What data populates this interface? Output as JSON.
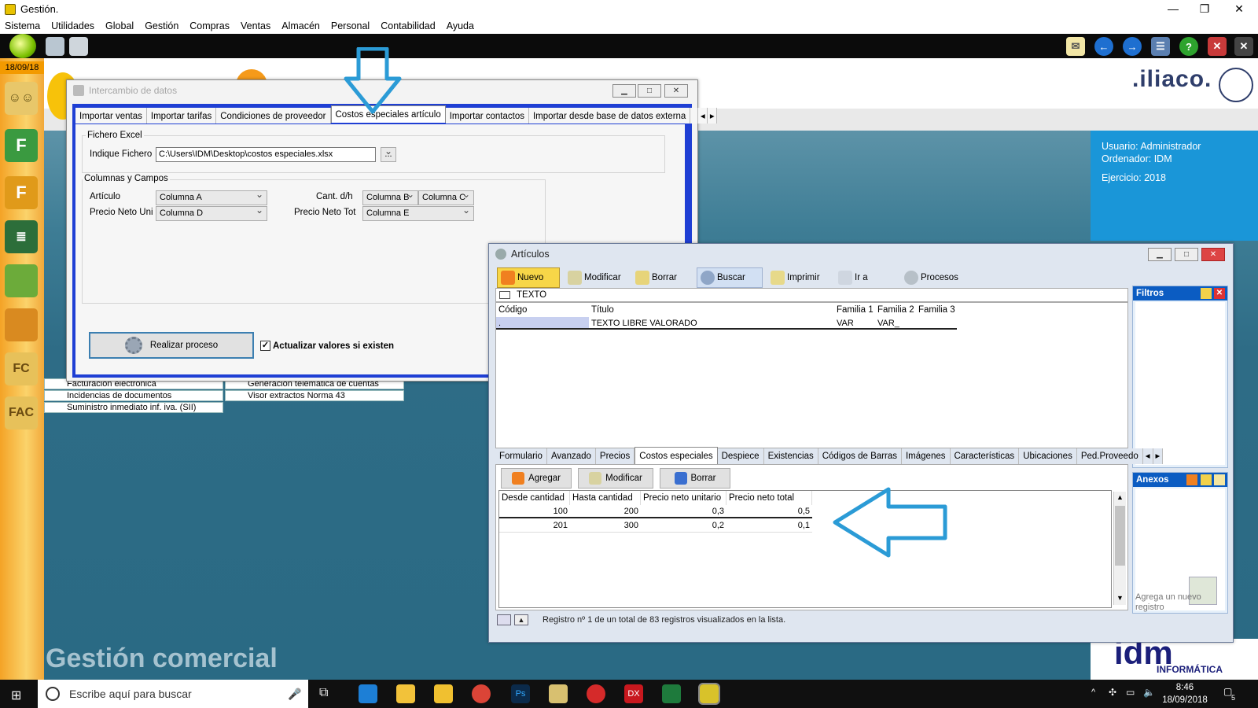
{
  "app": {
    "title": "Gestión.",
    "date_badge": "18/09/18"
  },
  "menu": [
    "Sistema",
    "Utilidades",
    "Global",
    "Gestión",
    "Compras",
    "Ventas",
    "Almacén",
    "Personal",
    "Contabilidad",
    "Ayuda"
  ],
  "logo_text": ".iliaco.",
  "user": {
    "line1": "Usuario: Administrador",
    "line2": "Ordenador: IDM",
    "line3": "Ejercicio: 2018"
  },
  "background_list": [
    {
      "label": "Facturación electrónica"
    },
    {
      "label": "Generación telemática de cuentas"
    },
    {
      "label": "Incidencias de documentos"
    },
    {
      "label": "Visor extractos Norma 43"
    },
    {
      "label": "Suministro inmediato inf. iva. (SII)"
    }
  ],
  "footer_title": "Gestión comercial",
  "idm_logo": {
    "brand": "idm",
    "sub": "INFORMÁTICA"
  },
  "intercambio": {
    "title": "Intercambio de datos",
    "tabs": [
      "Importar ventas",
      "Importar tarifas",
      "Condiciones de proveedor",
      "Costos especiales artículo",
      "Importar contactos",
      "Importar desde base de datos externa"
    ],
    "active_tab": "Costos especiales artículo",
    "group_excel": "Fichero Excel",
    "file_label": "Indique Fichero",
    "file_value": "C:\\Users\\IDM\\Desktop\\costos especiales.xlsx",
    "browse_label": "...",
    "group_cols": "Columnas y Campos",
    "fields": {
      "articulo_label": "Artículo",
      "articulo_value": "Columna A",
      "pnu_label": "Precio Neto Uni",
      "pnu_value": "Columna D",
      "cant_label": "Cant. d/h",
      "cant_value1": "Columna B",
      "cant_value2": "Columna C",
      "pnt_label": "Precio Neto Tot",
      "pnt_value": "Columna E"
    },
    "process_button": "Realizar proceso",
    "update_checkbox": "Actualizar valores si existen",
    "update_checked": true
  },
  "articulos": {
    "title": "Artículos",
    "toolbar": [
      "Nuevo",
      "Modificar",
      "Borrar",
      "Buscar",
      "Imprimir",
      "Ir a",
      "Procesos"
    ],
    "search_value": "TEXTO",
    "columns": [
      "Código",
      "Título",
      "Familia 1",
      "Familia 2",
      "Familia 3"
    ],
    "rows": [
      {
        "codigo": ".",
        "titulo": "TEXTO LIBRE VALORADO",
        "fam1": "VAR",
        "fam2": "VAR_",
        "fam3": ""
      }
    ],
    "filtros_label": "Filtros",
    "anexos_label": "Anexos",
    "anexos_hint": "Agrega un nuevo registro",
    "tabs": [
      "Formulario",
      "Avanzado",
      "Precios",
      "Costos especiales",
      "Despiece",
      "Existencias",
      "Códigos de Barras",
      "Imágenes",
      "Características",
      "Ubicaciones",
      "Ped.Proveedo"
    ],
    "active_tab": "Costos especiales",
    "sub_buttons": [
      "Agregar",
      "Modificar",
      "Borrar"
    ],
    "cost_columns": [
      "Desde cantidad",
      "Hasta cantidad",
      "Precio neto unitario",
      "Precio neto total"
    ],
    "cost_rows": [
      {
        "desde": "100",
        "hasta": "200",
        "unit": "0,3",
        "total": "0,5"
      },
      {
        "desde": "201",
        "hasta": "300",
        "unit": "0,2",
        "total": "0,1"
      }
    ],
    "status": "Registro nº 1 de un total de 83 registros visualizados en la lista."
  },
  "taskbar": {
    "search_placeholder": "Escribe aquí para buscar",
    "time": "8:46",
    "date": "18/09/2018",
    "notif_count": "5"
  },
  "colors": {
    "accent_blue": "#1a96d8",
    "arrow_blue": "#2b9bd6",
    "frame_blue": "#1f3fd4",
    "panel_head": "#0b5cc2"
  }
}
